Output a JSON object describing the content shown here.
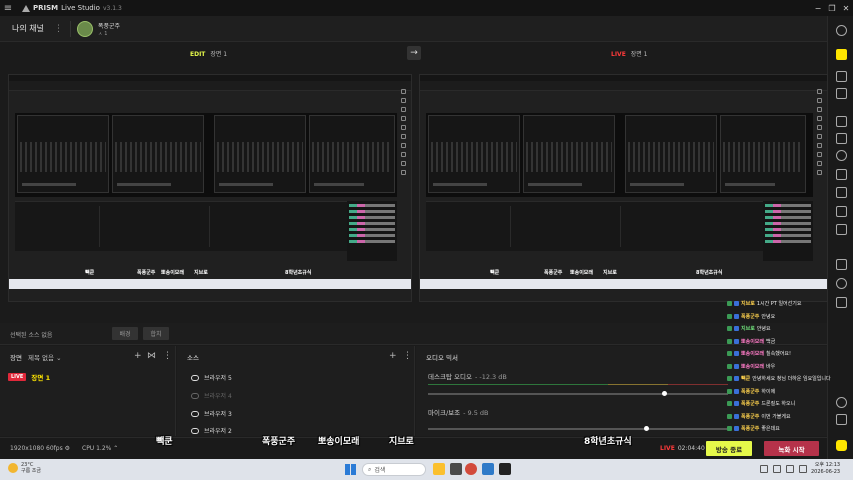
{
  "app": {
    "name": "PRISM",
    "subtitle": "Live Studio",
    "version": "v3.1.3"
  },
  "channel_bar": {
    "label": "나의 채널",
    "profile_name": "폭풍군주",
    "profile_sub": "ㅅ 1"
  },
  "mode_bar": {
    "edit_tag": "EDIT",
    "edit_scene": "장면 1",
    "live_tag": "LIVE",
    "live_scene": "장면 1"
  },
  "preview_names": [
    "빽쿤",
    "폭풍군주",
    "뽀송이모래",
    "지브로",
    "8학년초규식"
  ],
  "chat": {
    "lines": [
      {
        "nick": "지브로",
        "text": "1시간 PT 일어선기요",
        "color": "yellow"
      },
      {
        "nick": "폭풍군주",
        "text": "안녕요",
        "color": "yellow"
      },
      {
        "nick": "지브로",
        "text": "안녕요",
        "color": "green"
      },
      {
        "nick": "뽀송이모래",
        "text": "백금",
        "color": "pink"
      },
      {
        "nick": "뽀송이모래",
        "text": "칠속했어요!",
        "color": "pink"
      },
      {
        "nick": "뽀송이모래",
        "text": "바우",
        "color": "pink"
      },
      {
        "nick": "빽쿤",
        "text": "안녕하세요 청님 더하운 임요일입니다",
        "color": "yellow"
      },
      {
        "nick": "폭풍군주",
        "text": "하이에",
        "color": "yellow"
      },
      {
        "nick": "폭풍군주",
        "text": "드론질도 하오니",
        "color": "yellow"
      },
      {
        "nick": "폭풍군주",
        "text": "이번 가볼게요",
        "color": "yellow"
      },
      {
        "nick": "폭풍군주",
        "text": "좋은데요",
        "color": "yellow"
      }
    ]
  },
  "strip": {
    "selected_label": "선택된 소스 없음",
    "btn1": "배경",
    "btn2": "합치"
  },
  "scene_panel": {
    "title": "장면",
    "filter": "제목 없음",
    "live_badge": "LIVE",
    "scene_name": "장면 1"
  },
  "source_panel": {
    "title": "소스",
    "items": [
      {
        "label": "브라우저 5",
        "dim": false
      },
      {
        "label": "브라우저 4",
        "dim": true
      },
      {
        "label": "브라우저 3",
        "dim": false
      },
      {
        "label": "브라우저 2",
        "dim": false
      }
    ]
  },
  "audio_panel": {
    "title": "오디오 믹서",
    "desktop_label": "데스크탑 오디오",
    "desktop_value": "- -12.3 dB",
    "mic_label": "마이크/보조",
    "mic_value": "- 9.5 dB",
    "desktop_volume_pct": 78,
    "mic_volume_pct": 72
  },
  "footer": {
    "resolution": "1920x1080",
    "fps": "60fps",
    "cpu": "CPU 1.2%",
    "live_tag": "LIVE",
    "timer": "02:04:40",
    "end_button": "방송 종료",
    "rec_button": "녹화 시작"
  },
  "overlay_names": [
    "빽쿤",
    "폭풍군주",
    "뽀송이모래",
    "지브로",
    "8학년초규식"
  ],
  "taskbar": {
    "temp": "23°C",
    "weather": "구름 조금",
    "search_placeholder": "검색",
    "time": "오후 12:13",
    "date": "2026-06-23"
  },
  "colors": {
    "accent_yellow": "#e5f84a",
    "live_red": "#ff3a3a",
    "record_btn": "#b5324a"
  }
}
